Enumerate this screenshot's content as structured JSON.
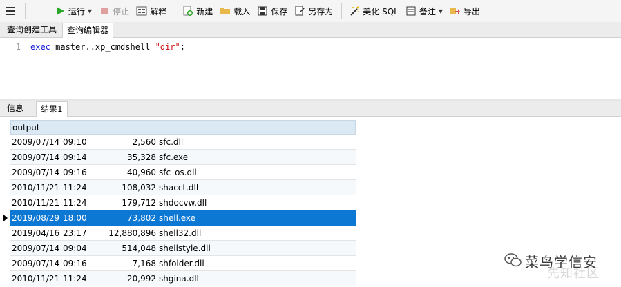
{
  "toolbar": {
    "run_label": "运行",
    "stop_label": "停止",
    "explain_label": "解释",
    "new_label": "新建",
    "load_label": "载入",
    "save_label": "保存",
    "saveas_label": "另存为",
    "beautify_label": "美化 SQL",
    "comment_label": "备注",
    "export_label": "导出"
  },
  "query_tabs": [
    "查询创建工具",
    "查询编辑器"
  ],
  "editor": {
    "line_number": "1",
    "kw": "exec",
    "middle": " master..xp_cmdshell ",
    "str": "\"dir\"",
    "end": ";"
  },
  "result_tabs": [
    "信息",
    "结果1"
  ],
  "grid": {
    "column": "output",
    "rows": [
      {
        "date": "2009/07/14",
        "time": "09:10",
        "size": "2,560",
        "name": "sfc.dll"
      },
      {
        "date": "2009/07/14",
        "time": "09:14",
        "size": "35,328",
        "name": "sfc.exe"
      },
      {
        "date": "2009/07/14",
        "time": "09:16",
        "size": "40,960",
        "name": "sfc_os.dll"
      },
      {
        "date": "2010/11/21",
        "time": "11:24",
        "size": "108,032",
        "name": "shacct.dll"
      },
      {
        "date": "2010/11/21",
        "time": "11:24",
        "size": "179,712",
        "name": "shdocvw.dll"
      },
      {
        "date": "2019/08/29",
        "time": "18:00",
        "size": "73,802",
        "name": "shell.exe"
      },
      {
        "date": "2019/04/16",
        "time": "23:17",
        "size": "12,880,896",
        "name": "shell32.dll"
      },
      {
        "date": "2009/07/14",
        "time": "09:04",
        "size": "514,048",
        "name": "shellstyle.dll"
      },
      {
        "date": "2009/07/14",
        "time": "09:16",
        "size": "7,168",
        "name": "shfolder.dll"
      },
      {
        "date": "2010/11/21",
        "time": "11:24",
        "size": "20,992",
        "name": "shgina.dll"
      }
    ]
  },
  "watermark": {
    "main": "菜鸟学信安",
    "sub": "先知社区"
  },
  "colors": {
    "selection": "#0c78d4",
    "header": "#dbe9f5",
    "run_green": "#2aa52a"
  }
}
